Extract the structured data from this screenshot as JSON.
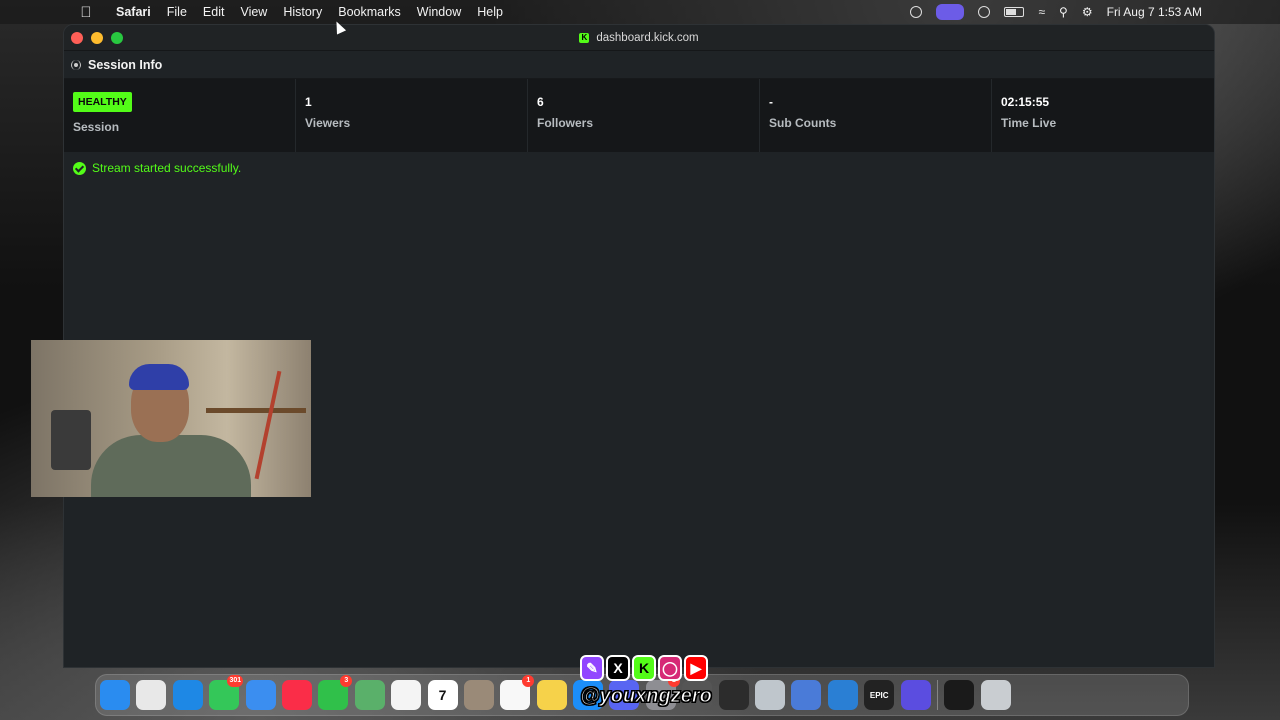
{
  "menubar": {
    "app_name": "Safari",
    "items": [
      "File",
      "Edit",
      "View",
      "History",
      "Bookmarks",
      "Window",
      "Help"
    ],
    "clock": "Fri Aug 7  1:53 AM"
  },
  "window": {
    "url": "dashboard.kick.com",
    "favicon_letter": "K"
  },
  "session_panel": {
    "title": "Session Info",
    "status_badge": "HEALTHY",
    "stats": [
      {
        "value": "",
        "label": "Session"
      },
      {
        "value": "1",
        "label": "Viewers"
      },
      {
        "value": "6",
        "label": "Followers"
      },
      {
        "value": "-",
        "label": "Sub Counts"
      },
      {
        "value": "02:15:55",
        "label": "Time Live"
      }
    ],
    "message": "Stream started successfully."
  },
  "overlay": {
    "handle": "@youxngzero",
    "icons": [
      "twitch-icon",
      "x-icon",
      "kick-icon",
      "instagram-icon",
      "youtube-icon"
    ]
  },
  "dock": {
    "apps": [
      {
        "name": "finder-icon",
        "color": "#2a8cf0",
        "badge": ""
      },
      {
        "name": "launchpad-icon",
        "color": "#e8e8e8",
        "badge": ""
      },
      {
        "name": "safari-icon",
        "color": "#1e88e5",
        "badge": ""
      },
      {
        "name": "messages-icon",
        "color": "#34c759",
        "badge": "301"
      },
      {
        "name": "mail-icon",
        "color": "#3b8ef0",
        "badge": ""
      },
      {
        "name": "music-icon",
        "color": "#fa2d48",
        "badge": ""
      },
      {
        "name": "facetime-icon",
        "color": "#30c04a",
        "badge": "3"
      },
      {
        "name": "maps-icon",
        "color": "#5ab06a",
        "badge": ""
      },
      {
        "name": "photos-icon",
        "color": "#f4f4f4",
        "badge": ""
      },
      {
        "name": "calendar-icon",
        "color": "#ffffff",
        "badge": ""
      },
      {
        "name": "contacts-icon",
        "color": "#9a8a78",
        "badge": ""
      },
      {
        "name": "reminders-icon",
        "color": "#f8f8f8",
        "badge": "1"
      },
      {
        "name": "notes-icon",
        "color": "#f6d24a",
        "badge": ""
      },
      {
        "name": "appstore-icon",
        "color": "#1c8ef9",
        "badge": ""
      },
      {
        "name": "discord-icon",
        "color": "#5865f2",
        "badge": ""
      },
      {
        "name": "settings-icon",
        "color": "#8e8e93",
        "badge": "1"
      },
      {
        "name": "compressor-icon",
        "color": "#555",
        "badge": ""
      },
      {
        "name": "obs-icon",
        "color": "#2c2c2c",
        "badge": ""
      },
      {
        "name": "preview-icon",
        "color": "#bfc6cc",
        "badge": ""
      },
      {
        "name": "files-icon",
        "color": "#4a7bd8",
        "badge": ""
      },
      {
        "name": "quicktime-icon",
        "color": "#2a7fd4",
        "badge": ""
      },
      {
        "name": "epic-games-icon",
        "color": "#222",
        "badge": ""
      },
      {
        "name": "apps-grid-icon",
        "color": "#5b4de0",
        "badge": ""
      },
      {
        "name": "terminal-icon",
        "color": "#1a1a1a",
        "badge": ""
      },
      {
        "name": "trash-icon",
        "color": "#c9cdd1",
        "badge": ""
      }
    ],
    "calendar_day": "7",
    "epic_label": "EPIC"
  }
}
